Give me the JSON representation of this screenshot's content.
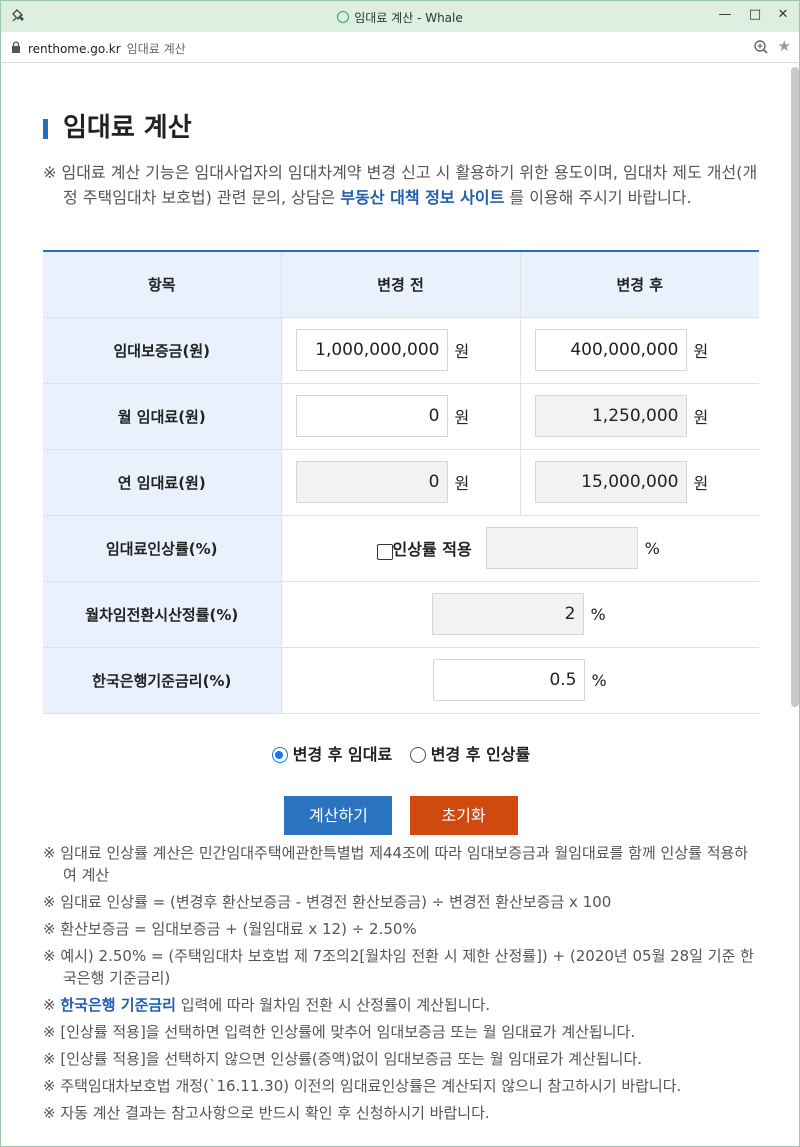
{
  "window": {
    "title": "임대료 계산 - Whale",
    "url": "renthome.go.kr",
    "page_title": "임대료 계산"
  },
  "page": {
    "heading": "임대료 계산",
    "intro_prefix": "※ 임대료 계산 기능은 임대사업자의 임대차계약 변경 신고 시 활용하기 위한 용도이며, 임대차 제도 개선(개정 주택임대차 보호법) 관련 문의, 상담은 ",
    "intro_link": "부동산 대책 정보 사이트",
    "intro_suffix": " 를 이용해 주시기 바랍니다."
  },
  "table": {
    "headers": [
      "항목",
      "변경 전",
      "변경 후"
    ],
    "rows": [
      {
        "label": "임대보증금(원)",
        "before": "1,000,000,000",
        "after": "400,000,000",
        "unit": "원"
      },
      {
        "label": "월 임대료(원)",
        "before": "0",
        "after": "1,250,000",
        "unit": "원"
      },
      {
        "label": "연 임대료(원)",
        "before": "0",
        "after": "15,000,000",
        "unit": "원"
      }
    ],
    "rate_row": {
      "label": "임대료인상률(%)",
      "checkbox_label": "인상률 적용",
      "value": "",
      "unit": "%"
    },
    "conv_row": {
      "label": "월차임전환시산정률(%)",
      "value": "2",
      "unit": "%"
    },
    "base_row": {
      "label": "한국은행기준금리(%)",
      "value": "0.5",
      "unit": "%"
    }
  },
  "mode": {
    "option1": "변경 후 임대료",
    "option2": "변경 후 인상률",
    "selected": "option1"
  },
  "buttons": {
    "calculate": "계산하기",
    "reset": "초기화"
  },
  "notes": [
    "※ 임대료 인상률 계산은 민간임대주택에관한특별법 제44조에 따라 임대보증금과 월임대료를 함께 인상률 적용하여 계산",
    "※ 임대료 인상률 = (변경후 환산보증금 - 변경전 환산보증금) ÷ 변경전 환산보증금 x 100",
    "※ 환산보증금 = 임대보증금 + (월임대료 x 12) ÷ 2.50%",
    "※ 예시) 2.50% = (주택임대차 보호법 제 7조의2[월차임 전환 시 제한 산정률]) + (2020년 05월 28일 기준 한국은행 기준금리)",
    "※ 자동 계산 결과는 참고사항으로 반드시 확인 후 신청하시기 바랍니다."
  ],
  "note_link": {
    "prefix": "※ ",
    "link": "한국은행 기준금리",
    "suffix": " 입력에 따라 월차임 전환 시 산정률이 계산됩니다."
  },
  "notes_mid": [
    "※ [인상률 적용]을 선택하면 입력한 인상률에 맞추어 임대보증금 또는 월 임대료가 계산됩니다.",
    "※ [인상률 적용]을 선택하지 않으면 인상률(증액)없이 임대보증금 또는 월 임대료가 계산됩니다.",
    "※ 주택임대차보호법 개정(`16.11.30) 이전의 임대료인상률은 계산되지 않으니 참고하시기 바랍니다."
  ],
  "colors": {
    "accent": "#1f6fc4",
    "calc_button": "#2a73c0",
    "reset_button": "#d04a10",
    "header_bg": "#e9f2fc"
  }
}
